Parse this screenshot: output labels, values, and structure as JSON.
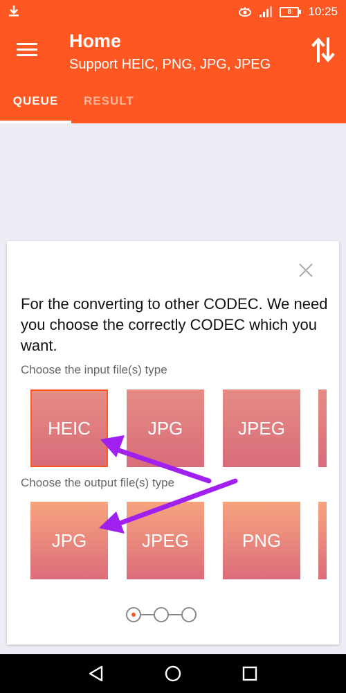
{
  "status_bar": {
    "time": "10:25",
    "battery": "8",
    "icons": [
      "download-icon",
      "eye-icon",
      "signal-icon",
      "battery-icon"
    ]
  },
  "app_bar": {
    "title": "Home",
    "subtitle": "Support HEIC, PNG, JPG, JPEG",
    "tabs": [
      {
        "label": "QUEUE",
        "active": true
      },
      {
        "label": "RESULT",
        "active": false
      }
    ],
    "menu_icon": "hamburger-menu-icon",
    "action_icon": "swap-vertical-icon"
  },
  "dialog": {
    "message": "For the converting to other CODEC. We need you choose the correctly CODEC which you want.",
    "input_label": "Choose the input file(s) type",
    "input_types": [
      "HEIC",
      "JPG",
      "JPEG"
    ],
    "output_label": "Choose the output file(s) type",
    "output_types": [
      "JPG",
      "JPEG",
      "PNG"
    ],
    "selected_input": "HEIC",
    "page_dots": 3,
    "active_dot": 1
  },
  "colors": {
    "accent": "#ff5722",
    "annotation_arrow": "#a020f0"
  },
  "nav_bar": {
    "icons": [
      "back-triangle-icon",
      "home-circle-icon",
      "recents-square-icon"
    ]
  }
}
